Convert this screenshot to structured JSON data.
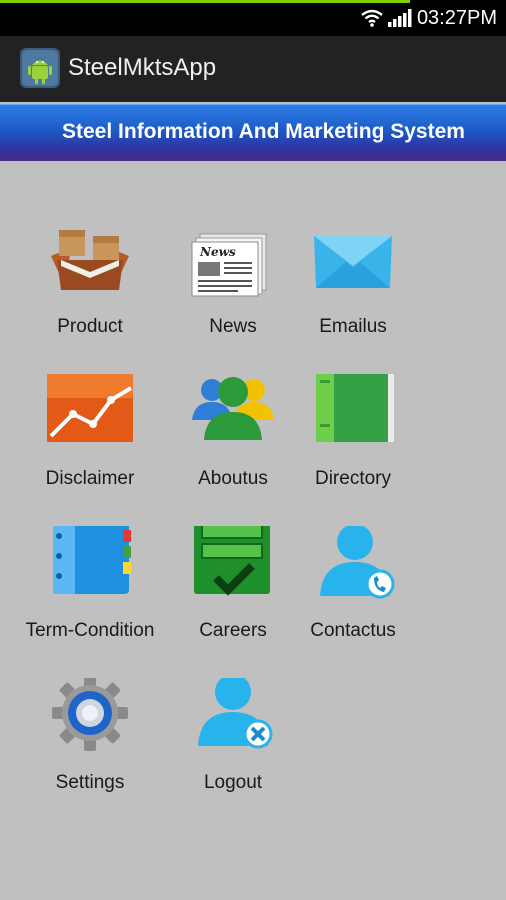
{
  "status_bar": {
    "time": "03:27PM"
  },
  "action_bar": {
    "title": "SteelMktsApp"
  },
  "banner": {
    "text": "Steel Information And Marketing System"
  },
  "menu": [
    {
      "label": "Product",
      "icon": "boxes-icon"
    },
    {
      "label": "News",
      "icon": "newspaper-icon"
    },
    {
      "label": "Emailus",
      "icon": "envelope-icon"
    },
    {
      "label": "Disclaimer",
      "icon": "line-chart-icon"
    },
    {
      "label": "Aboutus",
      "icon": "users-group-icon"
    },
    {
      "label": "Directory",
      "icon": "green-book-icon"
    },
    {
      "label": "Term-Condition",
      "icon": "notebook-icon"
    },
    {
      "label": "Careers",
      "icon": "checklist-icon"
    },
    {
      "label": "Contactus",
      "icon": "user-phone-icon"
    },
    {
      "label": "Settings",
      "icon": "gear-icon"
    },
    {
      "label": "Logout",
      "icon": "user-remove-icon"
    }
  ],
  "colors": {
    "background": "#c0c0c0",
    "action_bar": "#222222",
    "banner_top": "#2f7ee8",
    "banner_bottom": "#4a2a88"
  }
}
